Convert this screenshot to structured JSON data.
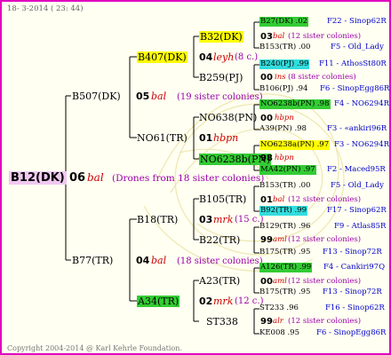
{
  "header": {
    "date": "18-  3-2014 ( 23: 44)"
  },
  "footer": {
    "copyright": "Copyright 2004-2014 @ Karl Kehrle Foundation."
  },
  "root": {
    "name": "B12(DK)",
    "gen": "06",
    "mark": "bal",
    "drones": "(Drones from 18 sister colonies)"
  },
  "level1": [
    {
      "name": "B507(DK)",
      "gen": "05",
      "mark": "bal",
      "sisters": "(19 sister colonies)"
    },
    {
      "name": "B77(TR)",
      "gen": "04",
      "mark": "bal",
      "sisters": "(18 sister colonies)"
    }
  ],
  "level2": [
    {
      "name": "B407(DK)",
      "gen": "04",
      "mark": "leyh",
      "sisters": "(8 c.)"
    },
    {
      "name": "NO61(TR)",
      "gen": "01",
      "mark": "hbpn",
      "sisters": ""
    },
    {
      "name": "B18(TR)",
      "gen": "03",
      "mark": "mrk",
      "sisters": "(15 c.)"
    },
    {
      "name": "A34(TR)",
      "gen": "02",
      "mark": "mrk",
      "sisters": "(12 c.)"
    }
  ],
  "level3": [
    {
      "name": "B32(DK)",
      "gen": "03",
      "mark": "bal",
      "sisters": "(12 sister colonies)"
    },
    {
      "name": "B259(PJ)",
      "gen": "",
      "mark": "",
      "sisters": ""
    },
    {
      "name": "NO638(PN)",
      "gen": "00",
      "mark": "hbpn",
      "sisters": ""
    },
    {
      "name": "NO6238b(PN)",
      "gen": "",
      "mark": "",
      "sisters": ""
    },
    {
      "name": "B105(TR)",
      "gen": "01",
      "mark": "bal",
      "sisters": "(12 sister colonies)"
    },
    {
      "name": "B22(TR)",
      "gen": "",
      "mark": "",
      "sisters": ""
    },
    {
      "name": "A23(TR)",
      "gen": "00",
      "mark": "aml",
      "sisters": "(12 sister colonies)"
    },
    {
      "name": "ST338",
      "gen": "",
      "mark": "",
      "sisters": ""
    }
  ],
  "level4": [
    {
      "name": "B27(DK) .02",
      "breeder": "F22 - Sinop62R",
      "gen": "03",
      "mark": "bal",
      "sisters": "(12 sister colonies)"
    },
    {
      "name": "B153(TR) .00",
      "breeder": "F5 - Old_Lady",
      "gen": "",
      "mark": "",
      "sisters": ""
    },
    {
      "name": "B240(PJ) .99",
      "breeder": "F11 - AthosSt80R",
      "gen": "00",
      "mark": "ins",
      "sisters": "(8 sister colonies)"
    },
    {
      "name": "B106(PJ) .94",
      "breeder": "F6 - SinopEgg86R",
      "gen": "",
      "mark": "",
      "sisters": ""
    },
    {
      "name": "NO6238b(PN) .98",
      "breeder": "F4 - NO6294R",
      "gen": "00",
      "mark": "hbpn",
      "sisters": ""
    },
    {
      "name": "A39(PN) .98",
      "breeder": "F3 - «ankiri96R",
      "gen": "",
      "mark": "",
      "sisters": ""
    },
    {
      "name": "NO6238a(PN) .97",
      "breeder": "F3 - NO6294R",
      "gen": "98",
      "mark": "hbpn",
      "sisters": ""
    },
    {
      "name": "MA42(PN) .97",
      "breeder": "F2 - Maced95R",
      "gen": "",
      "mark": "",
      "sisters": ""
    },
    {
      "name": "B153(TR) .00",
      "breeder": "F5 - Old_Lady",
      "gen": "01",
      "mark": "bal",
      "sisters": "(12 sister colonies)"
    },
    {
      "name": "B92(TR) .99",
      "breeder": "F17 - Sinop62R",
      "gen": "",
      "mark": "",
      "sisters": ""
    },
    {
      "name": "B129(TR) .96",
      "breeder": "F9 - Atlas85R",
      "gen": "99",
      "mark": "aml",
      "sisters": "(12 sister colonies)"
    },
    {
      "name": "B175(TR) .95",
      "breeder": "F13 - Sinop72R",
      "gen": "",
      "mark": "",
      "sisters": ""
    },
    {
      "name": "A126(TR) .99",
      "breeder": "F4 - Cankiri97Q",
      "gen": "00",
      "mark": "aml",
      "sisters": "(12 sister colonies)"
    },
    {
      "name": "B175(TR) .95",
      "breeder": "F13 - Sinop72R",
      "gen": "",
      "mark": "",
      "sisters": ""
    },
    {
      "name": "ST233 .96",
      "breeder": "F16 - Sinop62R",
      "gen": "99",
      "mark": "alr",
      "sisters": "(12 sister colonies)"
    },
    {
      "name": "KE008 .95",
      "breeder": "F6 - SinopEgg86R",
      "gen": "",
      "mark": "",
      "sisters": ""
    }
  ],
  "colors": {
    "frame": "#e000c0",
    "green": "#33cc33",
    "yellow": "#ffff00",
    "cyan": "#33dddd",
    "root_bg": "#f0c8f0",
    "line": "#000000"
  }
}
